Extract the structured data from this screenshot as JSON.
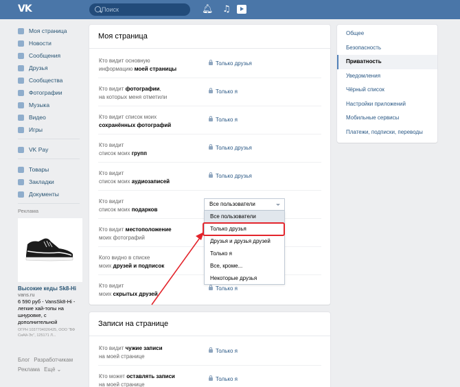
{
  "header": {
    "logo": "VK",
    "search_placeholder": "Поиск"
  },
  "sidebar": {
    "items": [
      {
        "label": "Моя страница",
        "icon": "user-icon"
      },
      {
        "label": "Новости",
        "icon": "news-icon"
      },
      {
        "label": "Сообщения",
        "icon": "messages-icon"
      },
      {
        "label": "Друзья",
        "icon": "friends-icon"
      },
      {
        "label": "Сообщества",
        "icon": "communities-icon"
      },
      {
        "label": "Фотографии",
        "icon": "camera-icon"
      },
      {
        "label": "Музыка",
        "icon": "music-icon"
      },
      {
        "label": "Видео",
        "icon": "video-icon"
      },
      {
        "label": "Игры",
        "icon": "games-icon"
      }
    ],
    "items2": [
      {
        "label": "VK Pay",
        "icon": "vkpay-icon"
      }
    ],
    "items3": [
      {
        "label": "Товары",
        "icon": "goods-icon"
      },
      {
        "label": "Закладки",
        "icon": "bookmark-icon"
      },
      {
        "label": "Документы",
        "icon": "document-icon"
      }
    ],
    "ad": {
      "title": "Реклама",
      "name": "Высокие кеды Sk8-Hi",
      "domain": "vans.ru",
      "desc": "6 590 руб - VansSk8-Hi - легкие хай-топы на шнуровке, с дополнительной",
      "legal": "ОГРН 1037704026425, ООО \"ВФ СиАй-Эс\", 125171 Л..."
    },
    "footer": {
      "blog": "Блог",
      "developers": "Разработчикам",
      "ads": "Реклама",
      "more": "Ещё ⌄"
    }
  },
  "main": {
    "section1_title": "Моя страница",
    "section2_title": "Записи на странице",
    "rows": [
      {
        "q1": "Кто видит основную",
        "q2a": "информацию ",
        "q2b": "моей страницы",
        "value": "Только друзья"
      },
      {
        "q1a": "Кто видит ",
        "q1b": "фотографии",
        "q1c": ",",
        "q2": "на которых меня отметили",
        "value": "Только я"
      },
      {
        "q1": "Кто видит список моих",
        "q2b": "сохранённых фотографий",
        "value": "Только я"
      },
      {
        "q1": "Кто видит",
        "q2a": "список моих ",
        "q2b": "групп",
        "value": "Только друзья"
      },
      {
        "q1": "Кто видит",
        "q2a": "список моих ",
        "q2b": "аудиозаписей",
        "value": "Только друзья"
      },
      {
        "q1": "Кто видит",
        "q2a": "список моих ",
        "q2b": "подарков",
        "value": "Все пользователи"
      },
      {
        "q1a": "Кто видит ",
        "q1b": "местоположение",
        "q2": "моих фотографий",
        "value": ""
      },
      {
        "q1": "Кого видно в списке",
        "q2a": "моих ",
        "q2b": "друзей и подписок",
        "value": ""
      },
      {
        "q1": "Кто видит",
        "q2a": "моих ",
        "q2b": "скрытых друзей",
        "value": "Только я"
      }
    ],
    "rows2": [
      {
        "q1a": "Кто видит ",
        "q1b": "чужие записи",
        "q2": "на моей странице",
        "value": "Только я"
      },
      {
        "q1a": "Кто может ",
        "q1b": "оставлять записи",
        "q2": "на моей странице",
        "value": "Только я"
      }
    ],
    "dropdown": {
      "selected": "Все пользователи",
      "options": [
        "Все пользователи",
        "Только друзья",
        "Друзья и друзья друзей",
        "Только я",
        "Все, кроме...",
        "Некоторые друзья"
      ],
      "hovered_index": 0,
      "highlighted_index": 1
    }
  },
  "rightnav": {
    "items": [
      "Общее",
      "Безопасность",
      "Приватность",
      "Уведомления",
      "Чёрный список",
      "Настройки приложений",
      "Мобильные сервисы",
      "Платежи, подписки, переводы"
    ],
    "active_index": 2
  },
  "colors": {
    "header": "#4a76a8",
    "link": "#2a5885",
    "highlight": "#e3242b"
  }
}
